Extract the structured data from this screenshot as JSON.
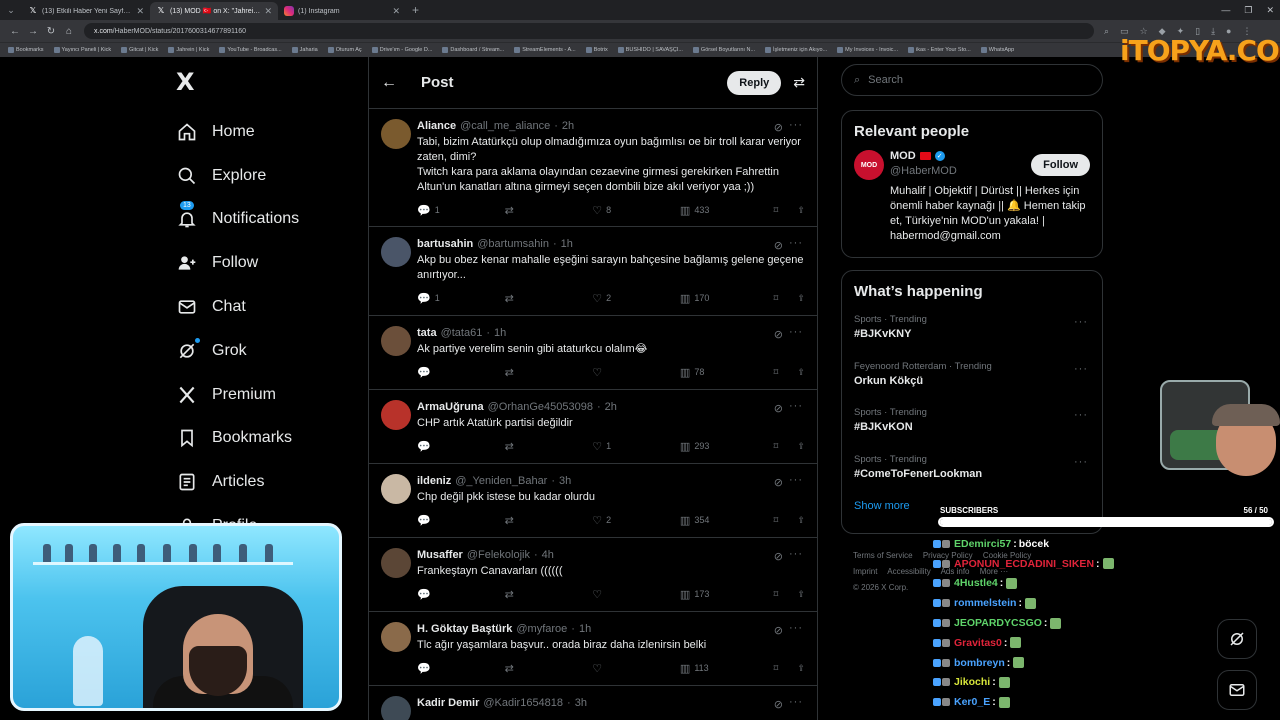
{
  "browser": {
    "tabs": [
      {
        "title": "(13) Etkili Haber Yeni Sayfa on X",
        "icon": "x-icon",
        "active": false
      },
      {
        "title": "(13) MOD 🇹🇷 on X: \"Jahreins \"C",
        "icon": "x-icon",
        "active": true
      },
      {
        "title": "(1) Instagram",
        "icon": "instagram-icon",
        "active": false
      }
    ],
    "url_host": "x.com",
    "url_path": "/HaberMOD/status/2017600314677891160",
    "bookmarks": [
      "Bookmarks",
      "Yayıncı Paneli | Kick",
      "Gitcat | Kick",
      "Jahrein | Kick",
      "YouTube - Broadcas...",
      "Jaharia",
      "Oturum Aç",
      "Drive'ım - Google D...",
      "Dashboard / Stream...",
      "StreamElements - A...",
      "Botrix",
      "BUSHIDO | SAVAŞÇI...",
      "Görsel Boyutlarını N...",
      "İşletmeniz için Akıyo...",
      "My Invoices - Invoic...",
      "ikas - Enter Your Sto...",
      "WhatsApp"
    ],
    "brand_overlay": "iTOPYA.COM"
  },
  "sidebar": {
    "logo": "X",
    "items": [
      {
        "label": "Home",
        "icon": "home-icon"
      },
      {
        "label": "Explore",
        "icon": "search-icon"
      },
      {
        "label": "Notifications",
        "icon": "bell-icon",
        "badge": "13"
      },
      {
        "label": "Follow",
        "icon": "add-user-icon"
      },
      {
        "label": "Chat",
        "icon": "mail-icon"
      },
      {
        "label": "Grok",
        "icon": "grok-icon"
      },
      {
        "label": "Premium",
        "icon": "x-premium-icon"
      },
      {
        "label": "Bookmarks",
        "icon": "bookmark-icon"
      },
      {
        "label": "Articles",
        "icon": "article-icon"
      },
      {
        "label": "Profile",
        "icon": "user-icon"
      }
    ]
  },
  "post_header": {
    "title": "Post",
    "reply_label": "Reply"
  },
  "replies": [
    {
      "name": "Aliance",
      "handle": "@call_me_aliance",
      "time": "2h",
      "text": "Tabi, bizim Atatürkçü olup olmadığımıza oyun bağımlısı oe bir troll karar veriyor zaten, dimi?\nTwitch kara para aklama olayından cezaevine girmesi gerekirken Fahrettin Altun'un kanatları altına girmeyi seçen dombili bize akıl veriyor yaa ;))",
      "replies": "1",
      "reposts": "",
      "likes": "8",
      "views": "433",
      "avatar_color": "#7a5a2e"
    },
    {
      "name": "bartusahin",
      "handle": "@bartumsahin",
      "time": "1h",
      "text": "Akp bu obez kenar mahalle eşeğini sarayın bahçesine bağlamış gelene geçene anırtıyor...",
      "replies": "1",
      "reposts": "",
      "likes": "2",
      "views": "170",
      "avatar_color": "#4a5568"
    },
    {
      "name": "tata",
      "handle": "@tata61",
      "time": "1h",
      "text": "Ak partiye verelim senin gibi ataturkcu olalım😂",
      "replies": "",
      "reposts": "",
      "likes": "",
      "views": "78",
      "avatar_color": "#6b4f3a"
    },
    {
      "name": "ArmaUğruna",
      "handle": "@OrhanGe45053098",
      "time": "2h",
      "text": "CHP artık Atatürk partisi değildir",
      "replies": "",
      "reposts": "",
      "likes": "1",
      "views": "293",
      "avatar_color": "#b8322a"
    },
    {
      "name": "ildeniz",
      "handle": "@_Yeniden_Bahar",
      "time": "3h",
      "text": "Chp değil pkk istese bu kadar olurdu",
      "replies": "",
      "reposts": "",
      "likes": "2",
      "views": "354",
      "avatar_color": "#c9b8a4"
    },
    {
      "name": "Musaffer",
      "handle": "@Felekolojik",
      "time": "4h",
      "text": "Frankeştayn Canavarları ((((((",
      "replies": "",
      "reposts": "",
      "likes": "",
      "views": "173",
      "avatar_color": "#5b4636"
    },
    {
      "name": "H. Göktay Baştürk",
      "handle": "@myfaroe",
      "time": "1h",
      "text": "Tlc ağır yaşamlara başvur.. orada biraz daha izlenirsin belki",
      "replies": "",
      "reposts": "",
      "likes": "",
      "views": "113",
      "avatar_color": "#8a6a4a"
    },
    {
      "name": "Kadir Demir",
      "handle": "@Kadir1654818",
      "time": "3h",
      "text": "",
      "replies": "",
      "reposts": "",
      "likes": "",
      "views": "",
      "avatar_color": "#3e4a55"
    }
  ],
  "search": {
    "placeholder": "Search"
  },
  "relevant_people": {
    "title": "Relevant people",
    "name": "MOD",
    "handle": "@HaberMOD",
    "avatar_text": "MOD",
    "follow_label": "Follow",
    "bio": "Muhalif | Objektif | Dürüst || Herkes için önemli haber kaynağı || 🔔 Hemen takip et, Türkiye'nin MOD'un yakala! | habermod@gmail.com"
  },
  "whats_happening": {
    "title": "What’s happening",
    "trends": [
      {
        "meta": "Sports · Trending",
        "name": "#BJKvKNY"
      },
      {
        "meta": "Feyenoord Rotterdam · Trending",
        "name": "Orkun Kökçü"
      },
      {
        "meta": "Sports · Trending",
        "name": "#BJKvKON"
      },
      {
        "meta": "Sports · Trending",
        "name": "#ComeToFenerLookman"
      }
    ],
    "show_more": "Show more"
  },
  "footer": {
    "links": [
      "Terms of Service",
      "Privacy Policy",
      "Cookie Policy",
      "Imprint",
      "Accessibility",
      "Ads info",
      "More ···"
    ],
    "copyright": "© 2026 X Corp."
  },
  "stream_overlay": {
    "subs_label": "SUBSCRIBERS",
    "subs_count": "56 / 50",
    "subs_progress": 1.0,
    "chat": [
      {
        "user": "EDemirci57",
        "color": "#5fd36a",
        "msg": "böcek",
        "emote": false
      },
      {
        "user": "APONUN_ECDADINI_SIKEN",
        "color": "#e0243a",
        "msg": "",
        "emote": true
      },
      {
        "user": "4Hustle4",
        "color": "#5fd36a",
        "msg": "",
        "emote": true
      },
      {
        "user": "rommelstein",
        "color": "#4aa3ff",
        "msg": "",
        "emote": true
      },
      {
        "user": "JEOPARDYCSGO",
        "color": "#5fd36a",
        "msg": "",
        "emote": true
      },
      {
        "user": "Gravitas0",
        "color": "#e0243a",
        "msg": "",
        "emote": true
      },
      {
        "user": "bombreyn",
        "color": "#4aa3ff",
        "msg": "",
        "emote": true
      },
      {
        "user": "Jikochi",
        "color": "#d7e63a",
        "msg": "",
        "emote": true
      },
      {
        "user": "Ker0_E",
        "color": "#4aa3ff",
        "msg": "",
        "emote": true
      }
    ]
  }
}
